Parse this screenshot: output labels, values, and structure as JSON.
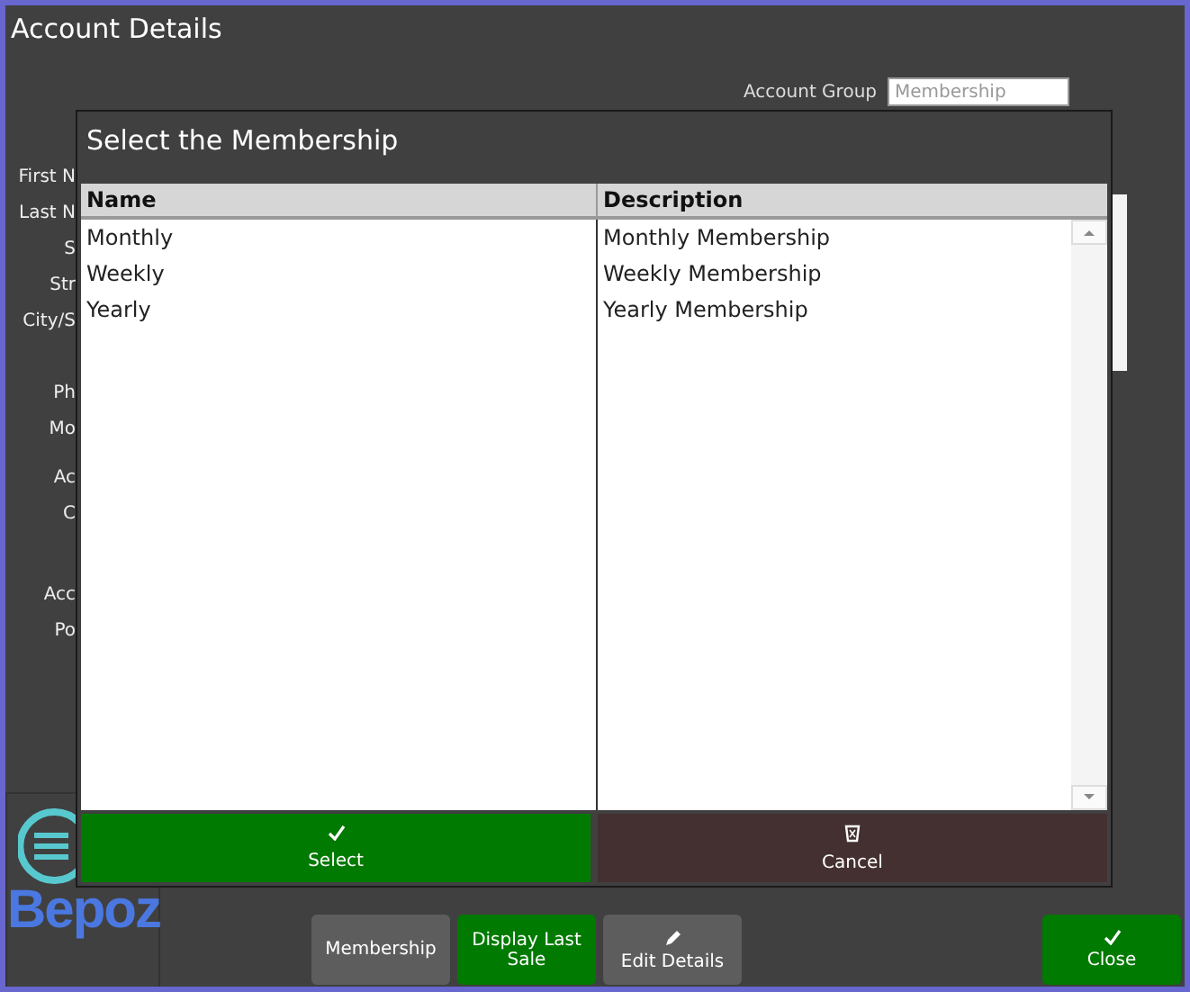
{
  "window": {
    "title": "Account Details"
  },
  "account_group": {
    "label": "Account Group",
    "value": "Membership"
  },
  "form_labels": [
    "First N",
    "Last N",
    "S",
    "Str",
    "City/S",
    "Ph",
    "Mo",
    "Ac",
    "C",
    "Acc",
    "Po"
  ],
  "logo": {
    "text": "Bepoz"
  },
  "dialog": {
    "title": "Select the Membership",
    "table": {
      "columns": [
        "Name",
        "Description"
      ],
      "rows": [
        {
          "name": "Monthly",
          "description": "Monthly Membership",
          "selected": false
        },
        {
          "name": "Weekly",
          "description": "Weekly Membership",
          "selected": false
        },
        {
          "name": "Yearly",
          "description": "Yearly Membership",
          "selected": false
        }
      ]
    },
    "buttons": [
      {
        "label": "Select",
        "kind": "confirm"
      },
      {
        "label": "Cancel",
        "kind": "cancel"
      }
    ]
  },
  "footer_buttons": [
    {
      "label": "Membership",
      "kind": "plain"
    },
    {
      "label": "Display Last Sale",
      "kind": "green"
    },
    {
      "label": "Edit Details",
      "kind": "edit"
    },
    {
      "label": "Close",
      "kind": "close"
    }
  ]
}
